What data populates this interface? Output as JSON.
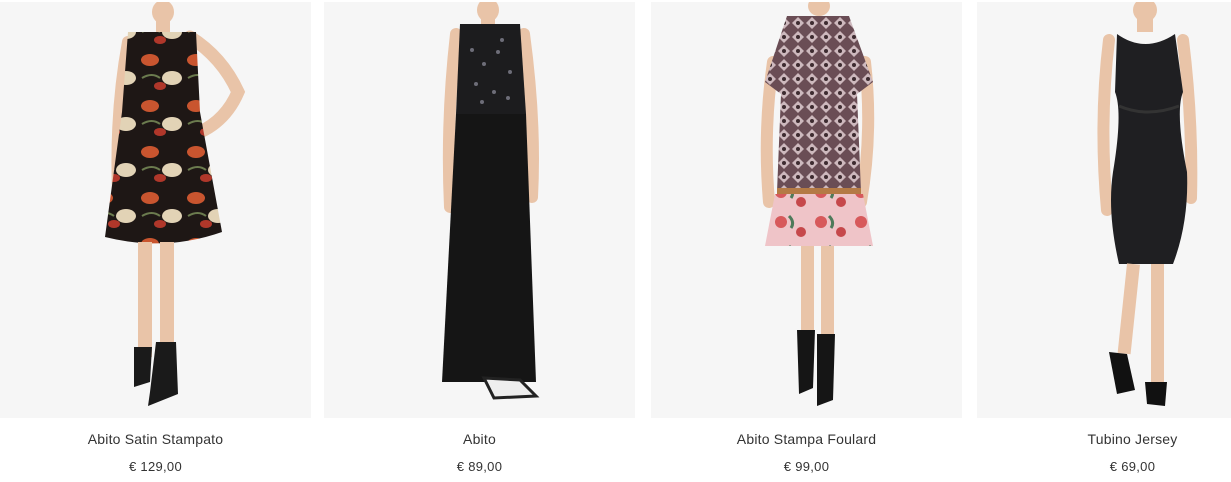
{
  "products": [
    {
      "name": "Abito Satin Stampato",
      "price": "€ 129,00"
    },
    {
      "name": "Abito",
      "price": "€ 89,00"
    },
    {
      "name": "Abito Stampa Foulard",
      "price": "€ 99,00"
    },
    {
      "name": "Tubino Jersey",
      "price": "€ 69,00"
    }
  ],
  "colors": {
    "background": "#ffffff",
    "image_bg": "#f6f6f6",
    "text": "#333333"
  }
}
